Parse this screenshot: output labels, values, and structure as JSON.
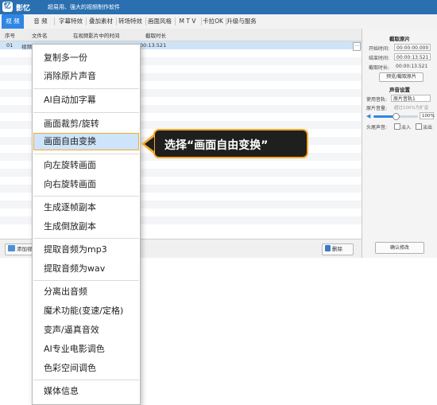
{
  "app": {
    "name": "影忆",
    "slogan": "超易用、强大的视频制作软件",
    "logo_glyph": "忆"
  },
  "tabs": [
    {
      "label": "视 频",
      "active": true
    },
    {
      "label": "音 频"
    },
    {
      "label": "字幕特效"
    },
    {
      "label": "叠加素材"
    },
    {
      "label": "转场特效"
    },
    {
      "label": "画面风格"
    },
    {
      "label": "M T V"
    },
    {
      "label": "卡拉OK"
    },
    {
      "label": "升级与服务"
    }
  ],
  "list": {
    "columns": [
      "序号",
      "文件名",
      "在视频影片中的时间",
      "截取时长"
    ],
    "rows": [
      {
        "index": "01",
        "filename": "视频",
        "time": "",
        "duration": "00:13.521"
      }
    ],
    "row_button": "⋯"
  },
  "bottom": {
    "add_label": "添加视",
    "delete_label": "删除"
  },
  "right_panel": {
    "clip_section": "截取原片",
    "start_label": "开始时间:",
    "start_value": "00:00:00.000",
    "end_label": "结束时间:",
    "end_value": "00:00:13.521",
    "clip_duration_label": "截取时长:",
    "clip_duration_value": "00:00:13.521",
    "preview_button": "预览/截取原片",
    "sound_section": "声音设置",
    "track_label": "使用音轨:",
    "track_value": "原片音轨1",
    "volume_label": "原片音量:",
    "volume_hint": "超过100%为扩音",
    "volume_value": "100%",
    "volume_fraction": 0.5,
    "fade_label": "头尾声音:",
    "fade_in": "淡入",
    "fade_out": "淡出",
    "confirm_button": "确认修改"
  },
  "context_menu": {
    "items": [
      "复制多一份",
      "消除原片声音",
      "AI自动加字幕",
      "画面裁剪/旋转",
      "画面自由变换",
      "向左旋转画面",
      "向右旋转画面",
      "生成逐帧副本",
      "生成倒放副本",
      "提取音频为mp3",
      "提取音频为wav",
      "分离出音频",
      "魔术功能(变速/定格)",
      "变声/逼真音效",
      "AI专业电影调色",
      "色彩空间调色",
      "媒体信息"
    ],
    "highlighted_index": 4
  },
  "callout": {
    "text": "选择“画面自由变换”"
  },
  "colors": {
    "accent": "#2f86e5",
    "highlight_border": "#f7a92b",
    "callout_bg": "#1f1f1f"
  }
}
